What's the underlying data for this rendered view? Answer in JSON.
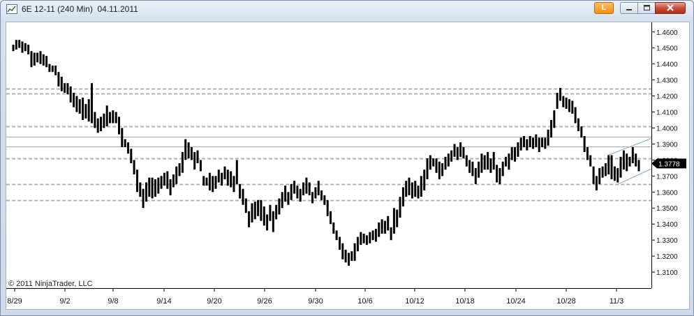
{
  "window": {
    "title": "6E 12-11 (240 Min)  04.11.2011",
    "link_button_label": "L",
    "app_icon": "chart-icon",
    "minimize_icon": "minimize-icon",
    "maximize_icon": "maximize-icon",
    "close_icon": "close-icon"
  },
  "copyright": "© 2011 NinjaTrader, LLC",
  "last_price_label": "1.3778",
  "colors": {
    "bars": "#000000",
    "dashed_levels": "#b0b0b0",
    "solid_levels": "#a8a8a8",
    "channel": "#7aa6d6",
    "price_marker": "#000000"
  },
  "chart_data": {
    "type": "bar",
    "subtype": "ohlc-range-bars",
    "y_axis_side": "right",
    "ylim": [
      1.3,
      1.466
    ],
    "y_ticks": [
      "1.4600",
      "1.4500",
      "1.4400",
      "1.4300",
      "1.4200",
      "1.4100",
      "1.4000",
      "1.3900",
      "1.3800",
      "1.3700",
      "1.3600",
      "1.3500",
      "1.3400",
      "1.3300",
      "1.3200",
      "1.3100"
    ],
    "x_ticks": [
      "8/29",
      "9/2",
      "9/8",
      "9/14",
      "9/20",
      "9/26",
      "9/30",
      "10/6",
      "10/12",
      "10/18",
      "10/24",
      "10/28",
      "11/3"
    ],
    "horizontal_levels_dashed": [
      1.4245,
      1.4215,
      1.401,
      1.381,
      1.365,
      1.355
    ],
    "horizontal_levels_solid": [
      1.3945,
      1.3885
    ],
    "channel": {
      "upper": [
        1.383,
        1.3935
      ],
      "lower": [
        1.3645,
        1.3745
      ]
    },
    "last_price": 1.3778,
    "bars": [
      [
        1.448,
        1.452
      ],
      [
        1.449,
        1.455
      ],
      [
        1.45,
        1.455
      ],
      [
        1.447,
        1.454
      ],
      [
        1.448,
        1.453
      ],
      [
        1.446,
        1.452
      ],
      [
        1.438,
        1.448
      ],
      [
        1.439,
        1.447
      ],
      [
        1.441,
        1.447
      ],
      [
        1.44,
        1.448
      ],
      [
        1.439,
        1.446
      ],
      [
        1.438,
        1.445
      ],
      [
        1.435,
        1.44
      ],
      [
        1.435,
        1.439
      ],
      [
        1.433,
        1.439
      ],
      [
        1.426,
        1.435
      ],
      [
        1.423,
        1.432
      ],
      [
        1.422,
        1.428
      ],
      [
        1.421,
        1.428
      ],
      [
        1.416,
        1.426
      ],
      [
        1.413,
        1.422
      ],
      [
        1.41,
        1.42
      ],
      [
        1.409,
        1.418
      ],
      [
        1.405,
        1.419
      ],
      [
        1.406,
        1.415
      ],
      [
        1.404,
        1.418
      ],
      [
        1.403,
        1.428
      ],
      [
        1.4,
        1.41
      ],
      [
        1.397,
        1.406
      ],
      [
        1.398,
        1.407
      ],
      [
        1.4,
        1.409
      ],
      [
        1.401,
        1.414
      ],
      [
        1.403,
        1.41
      ],
      [
        1.403,
        1.411
      ],
      [
        1.403,
        1.41
      ],
      [
        1.396,
        1.407
      ],
      [
        1.388,
        1.4
      ],
      [
        1.388,
        1.393
      ],
      [
        1.384,
        1.391
      ],
      [
        1.378,
        1.387
      ],
      [
        1.371,
        1.38
      ],
      [
        1.36,
        1.374
      ],
      [
        1.357,
        1.366
      ],
      [
        1.35,
        1.362
      ],
      [
        1.354,
        1.366
      ],
      [
        1.357,
        1.369
      ],
      [
        1.356,
        1.369
      ],
      [
        1.357,
        1.368
      ],
      [
        1.359,
        1.369
      ],
      [
        1.362,
        1.37
      ],
      [
        1.364,
        1.372
      ],
      [
        1.362,
        1.373
      ],
      [
        1.358,
        1.368
      ],
      [
        1.363,
        1.371
      ],
      [
        1.365,
        1.376
      ],
      [
        1.37,
        1.378
      ],
      [
        1.372,
        1.385
      ],
      [
        1.38,
        1.393
      ],
      [
        1.381,
        1.391
      ],
      [
        1.38,
        1.388
      ],
      [
        1.374,
        1.385
      ],
      [
        1.378,
        1.386
      ],
      [
        1.373,
        1.38
      ],
      [
        1.364,
        1.37
      ],
      [
        1.364,
        1.369
      ],
      [
        1.361,
        1.372
      ],
      [
        1.36,
        1.37
      ],
      [
        1.362,
        1.37
      ],
      [
        1.366,
        1.374
      ],
      [
        1.364,
        1.372
      ],
      [
        1.368,
        1.376
      ],
      [
        1.364,
        1.374
      ],
      [
        1.363,
        1.373
      ],
      [
        1.36,
        1.37
      ],
      [
        1.365,
        1.38
      ],
      [
        1.356,
        1.365
      ],
      [
        1.352,
        1.362
      ],
      [
        1.347,
        1.356
      ],
      [
        1.338,
        1.348
      ],
      [
        1.341,
        1.353
      ],
      [
        1.343,
        1.354
      ],
      [
        1.345,
        1.355
      ],
      [
        1.342,
        1.355
      ],
      [
        1.339,
        1.351
      ],
      [
        1.336,
        1.346
      ],
      [
        1.342,
        1.352
      ],
      [
        1.335,
        1.348
      ],
      [
        1.343,
        1.352
      ],
      [
        1.346,
        1.356
      ],
      [
        1.35,
        1.36
      ],
      [
        1.354,
        1.364
      ],
      [
        1.352,
        1.36
      ],
      [
        1.355,
        1.365
      ],
      [
        1.359,
        1.367
      ],
      [
        1.356,
        1.364
      ],
      [
        1.354,
        1.362
      ],
      [
        1.358,
        1.366
      ],
      [
        1.359,
        1.369
      ],
      [
        1.358,
        1.366
      ],
      [
        1.353,
        1.36
      ],
      [
        1.356,
        1.363
      ],
      [
        1.358,
        1.367
      ],
      [
        1.355,
        1.361
      ],
      [
        1.352,
        1.358
      ],
      [
        1.345,
        1.355
      ],
      [
        1.34,
        1.348
      ],
      [
        1.334,
        1.341
      ],
      [
        1.33,
        1.336
      ],
      [
        1.324,
        1.332
      ],
      [
        1.318,
        1.328
      ],
      [
        1.316,
        1.324
      ],
      [
        1.314,
        1.322
      ],
      [
        1.317,
        1.323
      ],
      [
        1.317,
        1.328
      ],
      [
        1.323,
        1.332
      ],
      [
        1.327,
        1.335
      ],
      [
        1.328,
        1.334
      ],
      [
        1.327,
        1.333
      ],
      [
        1.328,
        1.335
      ],
      [
        1.33,
        1.336
      ],
      [
        1.329,
        1.337
      ],
      [
        1.332,
        1.341
      ],
      [
        1.334,
        1.343
      ],
      [
        1.334,
        1.342
      ],
      [
        1.336,
        1.345
      ],
      [
        1.33,
        1.338
      ],
      [
        1.334,
        1.35
      ],
      [
        1.338,
        1.349
      ],
      [
        1.344,
        1.357
      ],
      [
        1.351,
        1.363
      ],
      [
        1.357,
        1.367
      ],
      [
        1.358,
        1.369
      ],
      [
        1.356,
        1.366
      ],
      [
        1.357,
        1.367
      ],
      [
        1.356,
        1.364
      ],
      [
        1.357,
        1.37
      ],
      [
        1.361,
        1.374
      ],
      [
        1.368,
        1.381
      ],
      [
        1.374,
        1.383
      ],
      [
        1.376,
        1.381
      ],
      [
        1.372,
        1.381
      ],
      [
        1.368,
        1.379
      ],
      [
        1.37,
        1.378
      ],
      [
        1.374,
        1.382
      ],
      [
        1.376,
        1.384
      ],
      [
        1.379,
        1.386
      ],
      [
        1.382,
        1.39
      ],
      [
        1.38,
        1.388
      ],
      [
        1.382,
        1.391
      ],
      [
        1.381,
        1.388
      ],
      [
        1.376,
        1.383
      ],
      [
        1.372,
        1.38
      ],
      [
        1.37,
        1.379
      ],
      [
        1.365,
        1.375
      ],
      [
        1.369,
        1.379
      ],
      [
        1.372,
        1.384
      ],
      [
        1.374,
        1.383
      ],
      [
        1.374,
        1.385
      ],
      [
        1.372,
        1.381
      ],
      [
        1.374,
        1.385
      ],
      [
        1.366,
        1.377
      ],
      [
        1.365,
        1.375
      ],
      [
        1.37,
        1.379
      ],
      [
        1.376,
        1.382
      ],
      [
        1.374,
        1.384
      ],
      [
        1.38,
        1.388
      ],
      [
        1.379,
        1.388
      ],
      [
        1.382,
        1.391
      ],
      [
        1.386,
        1.394
      ],
      [
        1.388,
        1.395
      ],
      [
        1.386,
        1.393
      ],
      [
        1.388,
        1.395
      ],
      [
        1.387,
        1.394
      ],
      [
        1.388,
        1.396
      ],
      [
        1.385,
        1.394
      ],
      [
        1.388,
        1.394
      ],
      [
        1.387,
        1.394
      ],
      [
        1.389,
        1.399
      ],
      [
        1.394,
        1.405
      ],
      [
        1.4,
        1.411
      ],
      [
        1.412,
        1.422
      ],
      [
        1.417,
        1.425
      ],
      [
        1.413,
        1.42
      ],
      [
        1.412,
        1.419
      ],
      [
        1.41,
        1.418
      ],
      [
        1.409,
        1.417
      ],
      [
        1.403,
        1.413
      ],
      [
        1.398,
        1.406
      ],
      [
        1.394,
        1.401
      ],
      [
        1.385,
        1.395
      ],
      [
        1.38,
        1.388
      ],
      [
        1.376,
        1.383
      ],
      [
        1.365,
        1.376
      ],
      [
        1.361,
        1.37
      ],
      [
        1.365,
        1.375
      ],
      [
        1.369,
        1.376
      ],
      [
        1.37,
        1.378
      ],
      [
        1.371,
        1.383
      ],
      [
        1.368,
        1.383
      ],
      [
        1.367,
        1.376
      ],
      [
        1.366,
        1.375
      ],
      [
        1.369,
        1.382
      ],
      [
        1.374,
        1.386
      ],
      [
        1.373,
        1.384
      ],
      [
        1.376,
        1.382
      ],
      [
        1.378,
        1.388
      ],
      [
        1.376,
        1.384
      ],
      [
        1.373,
        1.38
      ]
    ]
  }
}
